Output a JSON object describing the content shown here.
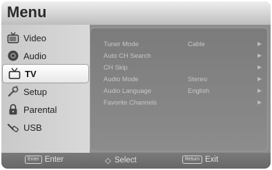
{
  "header": {
    "title": "Menu"
  },
  "sidebar": {
    "items": [
      {
        "label": "Video",
        "icon": "tv-set-icon"
      },
      {
        "label": "Audio",
        "icon": "speaker-icon"
      },
      {
        "label": "TV",
        "icon": "antenna-tv-icon",
        "selected": true
      },
      {
        "label": "Setup",
        "icon": "wrench-icon"
      },
      {
        "label": "Parental",
        "icon": "padlock-icon"
      },
      {
        "label": "USB",
        "icon": "usb-plug-icon"
      }
    ]
  },
  "settings": {
    "rows": [
      {
        "name": "Tuner Mode",
        "value": "Cable"
      },
      {
        "name": "Auto CH Search",
        "value": ""
      },
      {
        "name": "CH Skip",
        "value": ""
      },
      {
        "name": "Audio Mode",
        "value": "Stereo"
      },
      {
        "name": "Audio Language",
        "value": "English"
      },
      {
        "name": "Favorite Channels",
        "value": ""
      }
    ],
    "arrow_glyph": "▶"
  },
  "footer": {
    "enter": {
      "key": "Enter",
      "label": "Enter"
    },
    "select": {
      "glyph": "◇",
      "label": "Select"
    },
    "exit": {
      "key": "Return",
      "label": "Exit"
    }
  }
}
